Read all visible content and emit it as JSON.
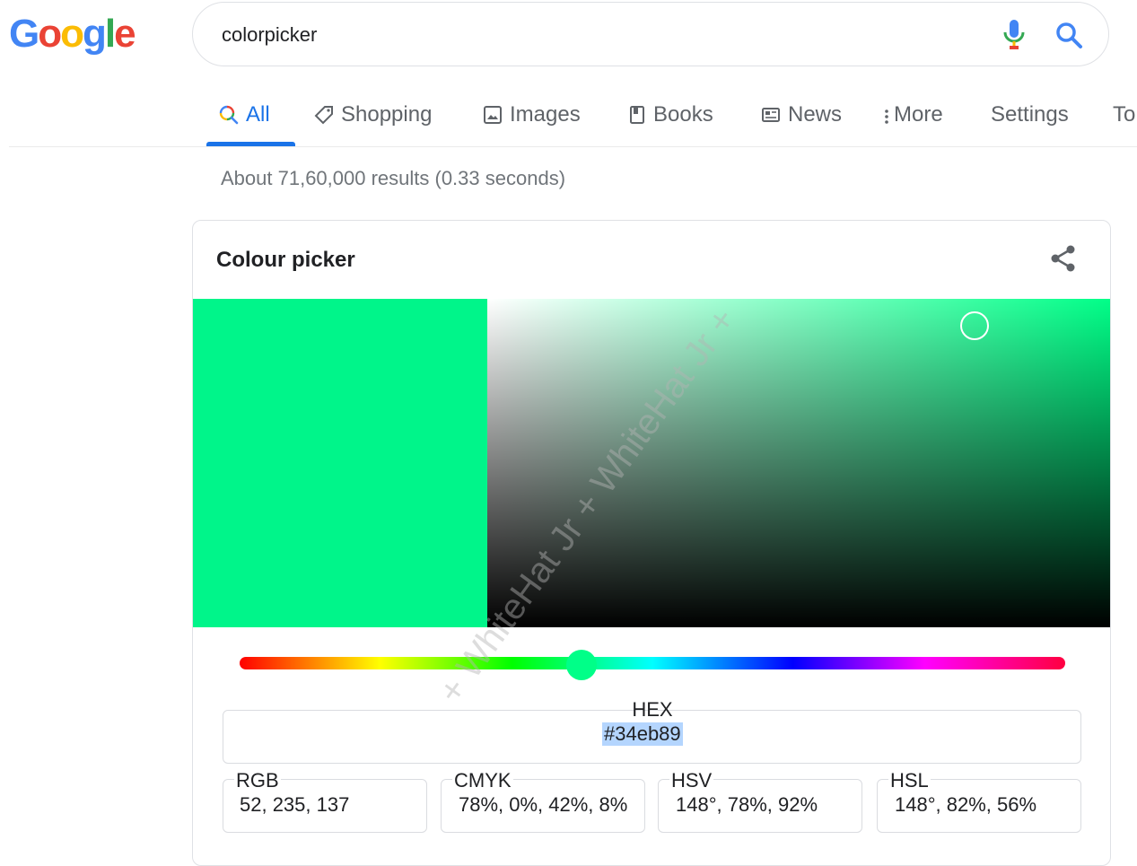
{
  "logo": {
    "text": "Google",
    "letters": [
      {
        "ch": "G",
        "color": "#4285f4"
      },
      {
        "ch": "o",
        "color": "#ea4335"
      },
      {
        "ch": "o",
        "color": "#fbbc05"
      },
      {
        "ch": "g",
        "color": "#4285f4"
      },
      {
        "ch": "l",
        "color": "#34a853"
      },
      {
        "ch": "e",
        "color": "#ea4335"
      }
    ]
  },
  "search": {
    "query": "colorpicker",
    "voice_icon": "microphone-icon",
    "search_icon": "magnifier-icon"
  },
  "tabs": [
    {
      "label": "All",
      "icon": "search-icon",
      "active": true
    },
    {
      "label": "Shopping",
      "icon": "tag-icon"
    },
    {
      "label": "Images",
      "icon": "image-icon"
    },
    {
      "label": "Books",
      "icon": "book-icon"
    },
    {
      "label": "News",
      "icon": "news-icon"
    },
    {
      "label": "More",
      "icon": "more-vert-icon"
    },
    {
      "label": "Settings"
    },
    {
      "label": "To"
    }
  ],
  "result_stats": "About 71,60,000 results (0.33 seconds)",
  "picker": {
    "title": "Colour picker",
    "share_icon": "share-icon",
    "selected_color": "#00f58a",
    "hue_color": "#00ff88",
    "saturation": 0.78,
    "brightness": 0.92,
    "hue_degrees": 148,
    "hex_label": "HEX",
    "hex_value": "#34eb89",
    "fields": [
      {
        "label": "RGB",
        "value": "52, 235, 137"
      },
      {
        "label": "CMYK",
        "value": "78%, 0%, 42%, 8%"
      },
      {
        "label": "HSV",
        "value": "148°, 78%, 92%"
      },
      {
        "label": "HSL",
        "value": "148°, 82%, 56%"
      }
    ],
    "watermark": "+ WhiteHat Jr + WhiteHat Jr +"
  },
  "colors": {
    "accent": "#1a73e8",
    "text_muted": "#70757a",
    "border": "#dfe1e5",
    "hex_highlight": "#b4d5fe"
  }
}
